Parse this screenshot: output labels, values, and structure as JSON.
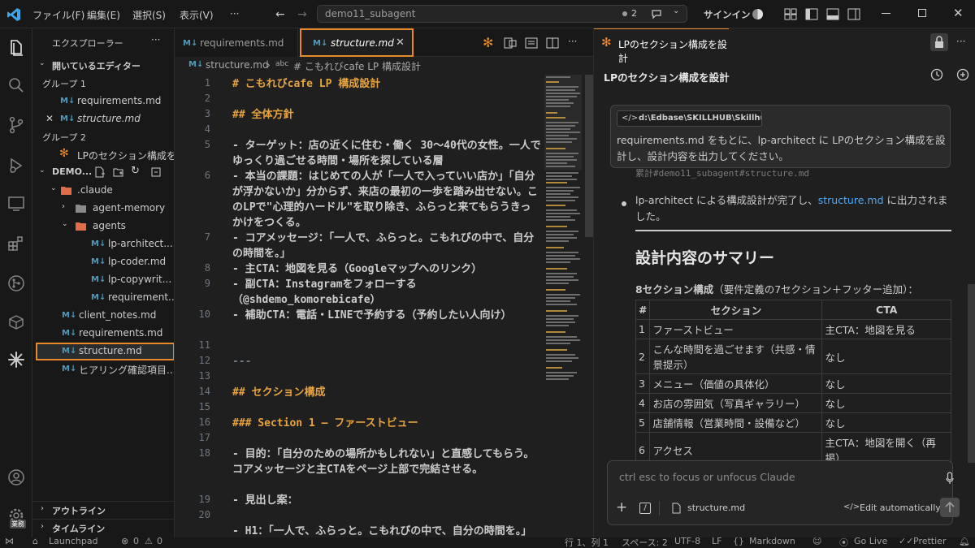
{
  "titlebar": {
    "menus": [
      "ファイル(F)",
      "編集(E)",
      "選択(S)",
      "表示(V)",
      "···"
    ],
    "search_text": "demo11_subagent",
    "agent_count": "2",
    "signin": "サインイン"
  },
  "sidebar": {
    "title": "エクスプローラー",
    "open_editors": "開いているエディター",
    "group1": "グループ 1",
    "group1_items": [
      "requirements.md",
      "structure.md"
    ],
    "group2": "グループ 2",
    "group2_items": [
      "LPのセクション構成を..."
    ],
    "workspace": "DEMO...",
    "tree": {
      "claude": ".claude",
      "agent_memory": "agent-memory",
      "agents": "agents",
      "agent_files": [
        "lp-architect....",
        "lp-coder.md",
        "lp-copywrit...",
        "requirement..."
      ],
      "root_files": [
        "client_notes.md",
        "requirements.md",
        "structure.md",
        "ヒアリング確認項目..."
      ]
    },
    "outline": "アウトライン",
    "timeline": "タイムライン",
    "badge": "業務"
  },
  "editor": {
    "tabs": [
      "requirements.md",
      "structure.md"
    ],
    "breadcrumb_file": "structure.md",
    "breadcrumb_symbol": "# こもれびcafe LP 構成設計",
    "lines": [
      {
        "n": "1",
        "text": "# こもれびcafe LP 構成設計"
      },
      {
        "n": "2",
        "text": ""
      },
      {
        "n": "3",
        "text": "## 全体方針"
      },
      {
        "n": "4",
        "text": ""
      },
      {
        "n": "5",
        "text": "- ターゲット：店の近くに住む・働く 30〜40代の女性。一人でゆっくり過ごせる時間・場所を探している層"
      },
      {
        "n": "6",
        "text": "- 本当の課題：はじめての人が「一人で入っていい店か」「自分が浮かないか」分からず、来店の最初の一歩を踏み出せない。このLPで\"心理的ハードル\"を取り除き、ふらっと来てもらうきっかけをつくる。"
      },
      {
        "n": "7",
        "text": "- コアメッセージ：「一人で、ふらっと。こもれびの中で、自分の時間を。」"
      },
      {
        "n": "8",
        "text": "- 主CTA：地図を見る（Googleマップへのリンク）"
      },
      {
        "n": "9",
        "text": "- 副CTA：Instagramをフォローする（@shdemo_komorebicafe）"
      },
      {
        "n": "10",
        "text": "- 補助CTA：電話・LINEで予約する（予約したい人向け）"
      },
      {
        "n": "11",
        "text": ""
      },
      {
        "n": "12",
        "text": "---"
      },
      {
        "n": "13",
        "text": ""
      },
      {
        "n": "14",
        "text": "## セクション構成"
      },
      {
        "n": "15",
        "text": ""
      },
      {
        "n": "16",
        "text": "### Section 1 — ファーストビュー"
      },
      {
        "n": "17",
        "text": ""
      },
      {
        "n": "18",
        "text": "- 目的：「自分のための場所かもしれない」と直感してもらう。コアメッセージと主CTAをページ上部で完結させる。"
      },
      {
        "n": "19",
        "text": "- 見出し案："
      },
      {
        "n": "20",
        "text": "  - H1：「一人で、ふらっと。こもれびの中で、自分の時間を。」"
      }
    ]
  },
  "panel": {
    "tab_title": "LPのセクション構成を設計",
    "header_title": "LPのセクション構成を設計",
    "path_chip": "d:\\Edbase\\SKILLHUB\\Skillhu...",
    "user_message": "requirements.md をもとに、lp-architect に LPのセクション構成を設計し、設計内容を出力してください。",
    "behind_text": "累計#demo11_subagent#structure.md",
    "bullet_pre": "lp-architect による構成設計が完了し、",
    "bullet_link": "structure.md",
    "bullet_post": " に出力されました。",
    "summary_heading": "設計内容のサマリー",
    "section_count_bold": "8セクション構成",
    "section_count_rest": "（要件定義の7セクション＋フッター追加）：",
    "table_headers": [
      "#",
      "セクション",
      "CTA"
    ],
    "table_rows": [
      [
        "1",
        "ファーストビュー",
        "主CTA：地図を見る"
      ],
      [
        "2",
        "こんな時間を過ごせます（共感・情景提示）",
        "なし"
      ],
      [
        "3",
        "メニュー（価値の具体化）",
        "なし"
      ],
      [
        "4",
        "お店の雰囲気（写真ギャラリー）",
        "なし"
      ],
      [
        "5",
        "店舗情報（営業時間・設備など）",
        "なし"
      ],
      [
        "6",
        "アクセス",
        "主CTA：地図を開く（再掲）"
      ]
    ],
    "input_placeholder": "ctrl esc to focus or unfocus Claude",
    "attached_file": "structure.md",
    "edit_mode": "Edit automatically"
  },
  "status": {
    "launchpad": "Launchpad",
    "errors": "0",
    "warnings": "0",
    "line": "行 1、列 1",
    "spaces": "スペース: 2",
    "encoding": "UTF-8",
    "eol": "LF",
    "language": "Markdown",
    "golive": "Go Live",
    "prettier": "Prettier"
  },
  "colors": {
    "accent_orange": "#e8892c",
    "link_blue": "#4daafc",
    "heading_gold": "#e7a33e",
    "md_icon_blue": "#519aba"
  }
}
